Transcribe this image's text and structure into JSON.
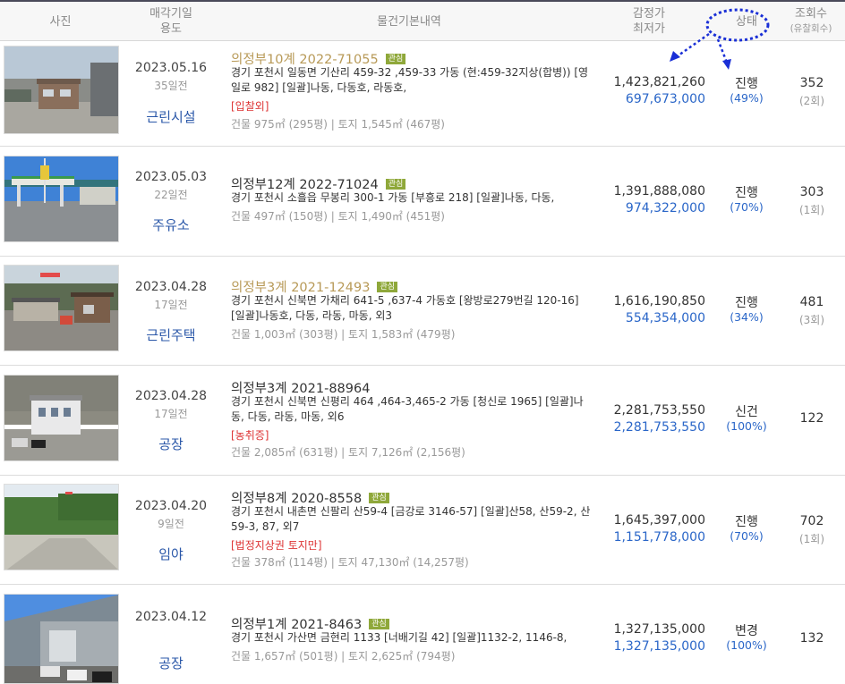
{
  "header": {
    "photo": "사진",
    "date_line1": "매각기일",
    "date_line2": "용도",
    "info": "물건기본내역",
    "price_line1": "감정가",
    "price_line2": "최저가",
    "status": "상태",
    "views_line1": "조회수",
    "views_line2": "(유찰회수)"
  },
  "colors": {
    "accent_blue": "#2a66c8",
    "highlight_gold": "#b89a58",
    "badge_green": "#8fa83a",
    "tag_red": "#dd3333",
    "annotation_blue": "#1a2fd6"
  },
  "items": [
    {
      "date": "2023.05.16",
      "ago": "35일전",
      "use": "근린시설",
      "case": "의정부10계 2022-71055",
      "badge": "관심",
      "addr": "경기 포천시 일동면 기산리 459-32 ,459-33 가동 (현:459-32지상(합병)) [영일로 982] [일괄]나동, 다동호, 라동호,",
      "tag": "[입찰외]",
      "area": "건물 975㎡ (295평)   |   토지 1,545㎡ (467평)",
      "appraise": "1,423,821,260",
      "min": "697,673,000",
      "status": "진행",
      "pct": "(49%)",
      "views": "352",
      "fails": "(2회)"
    },
    {
      "date": "2023.05.03",
      "ago": "22일전",
      "use": "주유소",
      "case": "의정부12계 2022-71024",
      "badge": "관심",
      "addr": "경기 포천시 소흘읍 무봉리 300-1 가동 [부흥로 218] [일괄]나동, 다동,",
      "tag": "",
      "area": "건물 497㎡ (150평)   |   토지 1,490㎡ (451평)",
      "appraise": "1,391,888,080",
      "min": "974,322,000",
      "status": "진행",
      "pct": "(70%)",
      "views": "303",
      "fails": "(1회)"
    },
    {
      "date": "2023.04.28",
      "ago": "17일전",
      "use": "근린주택",
      "case": "의정부3계 2021-12493",
      "badge": "관심",
      "addr": "경기 포천시 신북면 가채리 641-5 ,637-4 가동호 [왕방로279번길 120-16] [일괄]나동호, 다동, 라동, 마동, 외3",
      "tag": "",
      "area": "건물 1,003㎡ (303평)   |   토지 1,583㎡ (479평)",
      "appraise": "1,616,190,850",
      "min": "554,354,000",
      "status": "진행",
      "pct": "(34%)",
      "views": "481",
      "fails": "(3회)"
    },
    {
      "date": "2023.04.28",
      "ago": "17일전",
      "use": "공장",
      "case": "의정부3계 2021-88964",
      "badge": "",
      "addr": "경기 포천시 신북면 신평리 464 ,464-3,465-2 가동 [청신로 1965] [일괄]나동, 다동, 라동, 마동, 외6",
      "tag": "[농취증]",
      "area": "건물 2,085㎡ (631평)   |   토지 7,126㎡ (2,156평)",
      "appraise": "2,281,753,550",
      "min": "2,281,753,550",
      "status": "신건",
      "pct": "(100%)",
      "views": "122",
      "fails": ""
    },
    {
      "date": "2023.04.20",
      "ago": "9일전",
      "use": "임야",
      "case": "의정부8계 2020-8558",
      "badge": "관심",
      "addr": "경기 포천시 내촌면 신팔리 산59-4 [금강로 3146-57] [일괄]산58, 산59-2, 산59-3, 87, 외7",
      "tag": "[법정지상권   토지만]",
      "area": "건물 378㎡ (114평)   |   토지 47,130㎡ (14,257평)",
      "appraise": "1,645,397,000",
      "min": "1,151,778,000",
      "status": "진행",
      "pct": "(70%)",
      "views": "702",
      "fails": "(1회)"
    },
    {
      "date": "2023.04.12",
      "ago": "",
      "use": "공장",
      "case": "의정부1계 2021-8463",
      "badge": "관심",
      "addr": "경기 포천시 가산면 금현리 1133 [너배기길 42] [일괄]1132-2, 1146-8,",
      "tag": "",
      "area": "건물 1,657㎡ (501평)   |   토지 2,625㎡ (794평)",
      "appraise": "1,327,135,000",
      "min": "1,327,135,000",
      "status": "변경",
      "pct": "(100%)",
      "views": "132",
      "fails": ""
    }
  ]
}
